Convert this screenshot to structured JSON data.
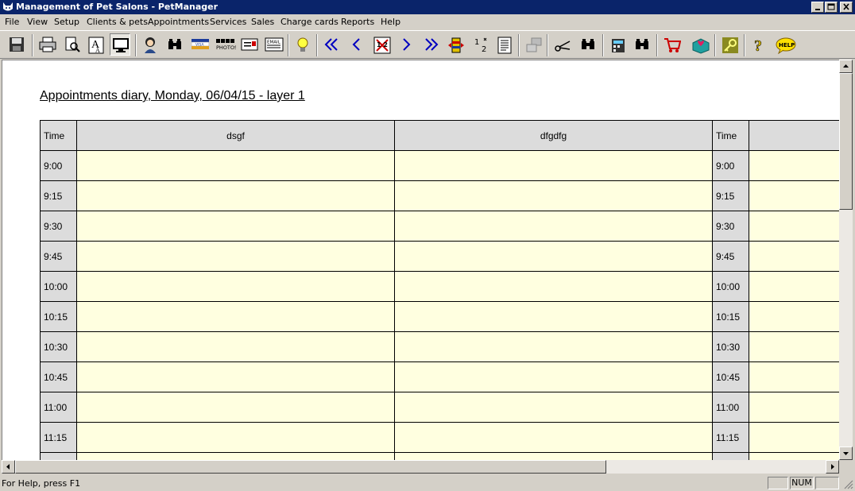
{
  "window": {
    "title": "Management of Pet Salons - PetManager"
  },
  "menu": [
    "File",
    "View",
    "Setup",
    "Clients & pets",
    "Appointments",
    "Services",
    "Sales",
    "Charge cards",
    "Reports",
    "Help"
  ],
  "toolbar": {
    "buttons": [
      "save-icon",
      "print-icon",
      "print-preview-icon",
      "font-icon",
      "monitor-icon",
      "client-icon",
      "binoculars-icon",
      "visa-card-icon",
      "photos-icon",
      "card-icon",
      "email-icon",
      "lightbulb-icon",
      "first-icon",
      "prev-icon",
      "calendar-icon",
      "next-icon",
      "last-icon",
      "layers-icon",
      "numbering-icon",
      "document-icon",
      "network-icon",
      "scissors-icon",
      "find-icon",
      "register-icon",
      "find-next-icon",
      "cart-icon",
      "gift-icon",
      "key-icon",
      "question-icon",
      "help-icon"
    ],
    "photos_label": "PHOTOS",
    "email_label": "EMAIL",
    "visa_label": "VISA",
    "help_label": "HELP",
    "pressed": "monitor-icon"
  },
  "diary": {
    "title": "Appointments diary, Monday, 06/04/15 - layer 1",
    "time_header": "Time",
    "columns": [
      "dsgf",
      "dfgdfg"
    ],
    "times": [
      "9:00",
      "9:15",
      "9:30",
      "9:45",
      "10:00",
      "10:15",
      "10:30",
      "10:45",
      "11:00",
      "11:15"
    ]
  },
  "status": {
    "text": "For Help, press F1",
    "num": "NUM"
  },
  "colors": {
    "title_bar": "#0a246a",
    "slot": "#ffffe0",
    "header": "#dcdcdc"
  }
}
